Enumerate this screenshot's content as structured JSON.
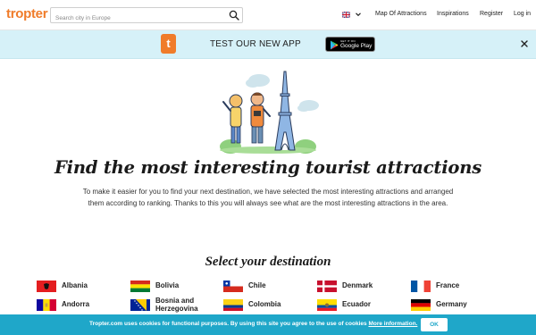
{
  "header": {
    "logo": "tropter",
    "search_placeholder": "Search city in Europe",
    "nav": {
      "map": "Map Of Attractions",
      "inspirations": "Inspirations",
      "register": "Register",
      "login": "Log in"
    }
  },
  "app_banner": {
    "logo_letter": "t",
    "text": "TEST OUR NEW APP",
    "store_small": "GET IT ON",
    "store_big": "Google Play"
  },
  "hero": {
    "title": "Find the most interesting tourist attractions",
    "description": "To make it easier for you to find your next destination, we have selected the most interesting attractions and arranged them according to ranking. Thanks to this you will always see what are the most interesting attractions in the area."
  },
  "destinations": {
    "title": "Select your destination",
    "items": [
      {
        "name": "Albania"
      },
      {
        "name": "Bolivia"
      },
      {
        "name": "Chile"
      },
      {
        "name": "Denmark"
      },
      {
        "name": "France"
      },
      {
        "name": "Andorra"
      },
      {
        "name": "Bosnia and Herzegovina"
      },
      {
        "name": "Colombia"
      },
      {
        "name": "Ecuador"
      },
      {
        "name": "Germany"
      }
    ]
  },
  "cookie": {
    "text": "Tropter.com uses cookies for functional purposes. By using this site you agree to the use of cookies",
    "link": "More information.",
    "ok": "OK"
  },
  "colors": {
    "brand": "#f07c2a",
    "banner_bg": "#d6f1f8",
    "cookie_bg": "#1fa7c9"
  }
}
